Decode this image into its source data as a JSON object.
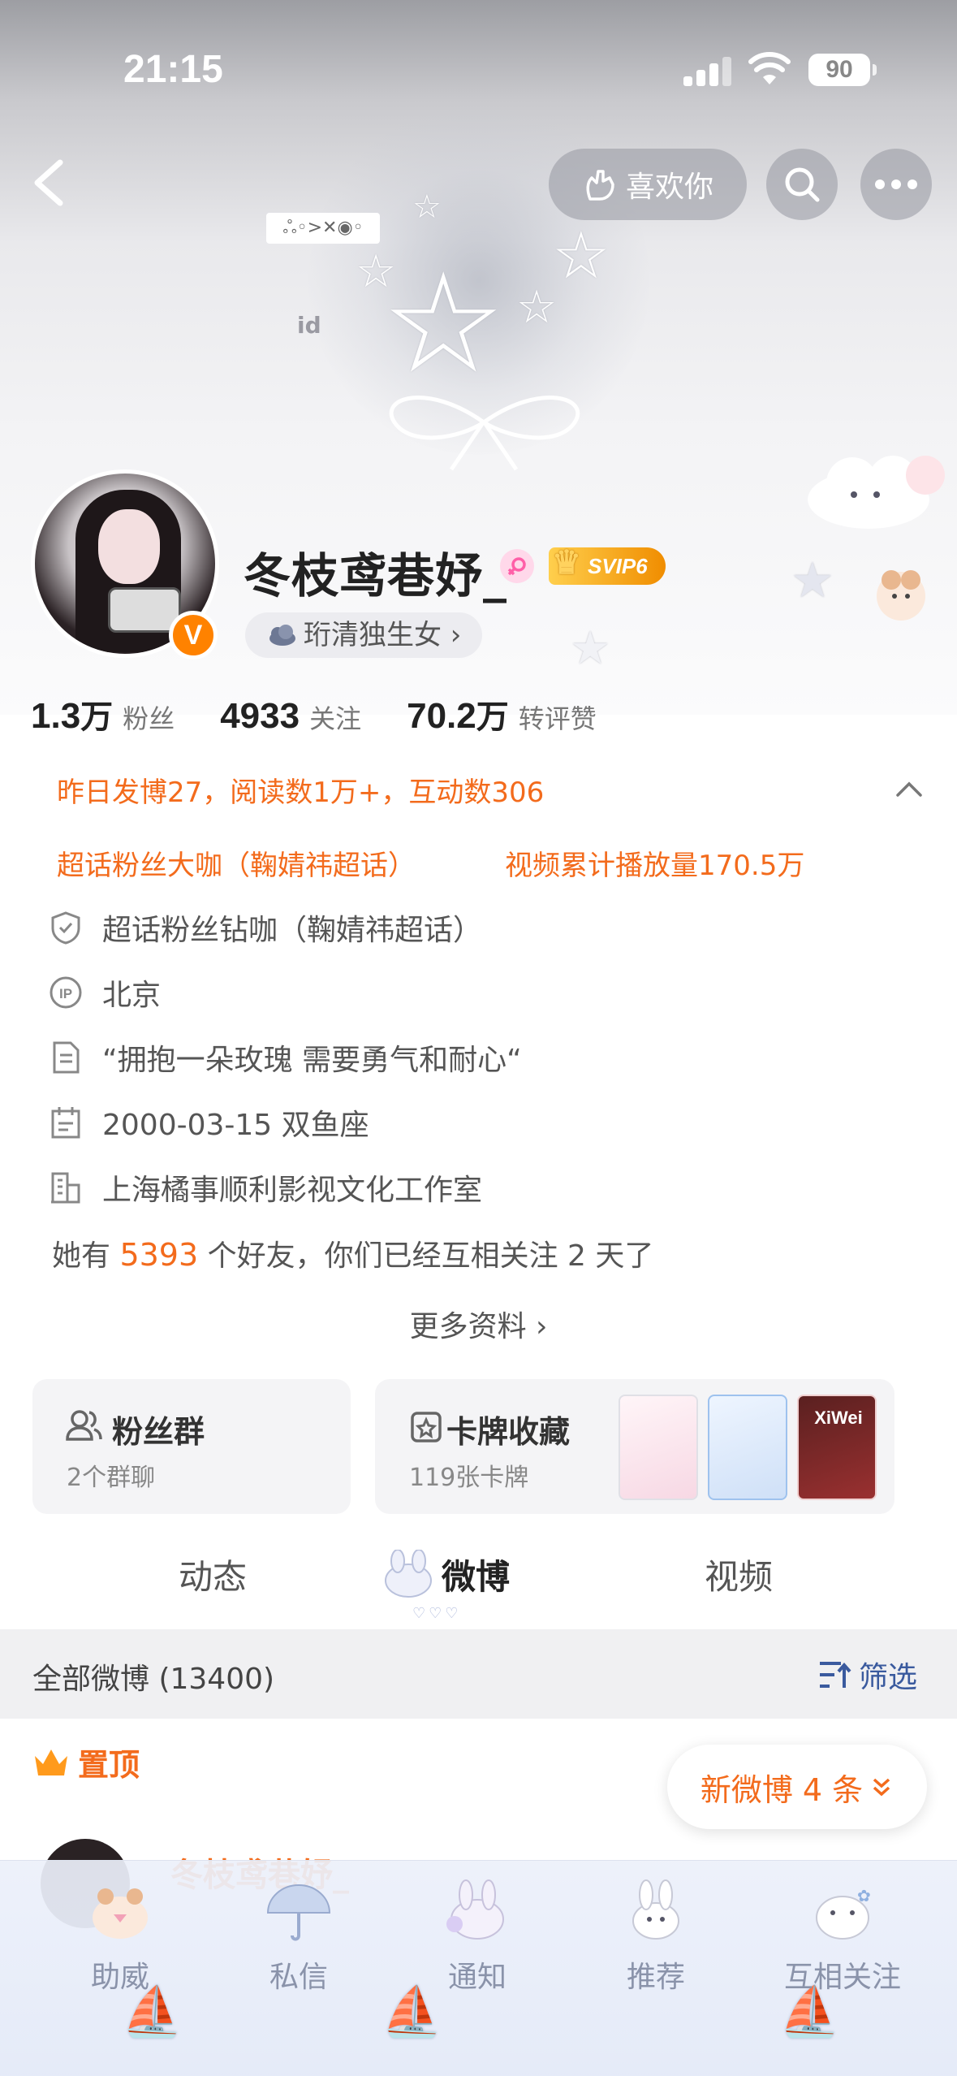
{
  "status_bar": {
    "time": "21:15",
    "battery": "90"
  },
  "header": {
    "like_button": "喜欢你",
    "banner_sticker_text": "ஃ◦>✕◉◦",
    "banner_small_text": "id"
  },
  "profile": {
    "username": "冬枝鸢巷妤_",
    "vip_badge": "SVIP6",
    "verified_mark": "V",
    "tag": "珩清独生女 ›",
    "stats": [
      {
        "num": "1.3",
        "unit": "万",
        "label": "粉丝"
      },
      {
        "num": "4933",
        "unit": "",
        "label": "关注"
      },
      {
        "num": "70.2",
        "unit": "万",
        "label": "转评赞"
      }
    ]
  },
  "info": {
    "yesterday": "昨日发博27，阅读数1万+，互动数306",
    "super_fan": "超话粉丝大咖（鞠婧祎超话）",
    "video_plays": "视频累计播放量170.5万",
    "rows": [
      {
        "icon": "shield-icon",
        "text": "超话粉丝钻咖（鞠婧祎超话）"
      },
      {
        "icon": "ip-icon",
        "text": "北京"
      },
      {
        "icon": "document-icon",
        "text": "“拥抱一朵玫瑰 需要勇气和耐心“"
      },
      {
        "icon": "calendar-icon",
        "text": "2000-03-15 双鱼座"
      },
      {
        "icon": "building-icon",
        "text": "上海橘事顺利影视文化工作室"
      }
    ],
    "friends_prefix": "她有 ",
    "friends_count": "5393",
    "friends_suffix": " 个好友，你们已经互相关注 2 天了",
    "more": "更多资料 ›"
  },
  "cards": {
    "fan_group": {
      "title": "粉丝群",
      "sub": "2个群聊"
    },
    "card_collection": {
      "title": "卡牌收藏",
      "sub": "119张卡牌",
      "thumb_label": "XiWei"
    }
  },
  "tabs": [
    "动态",
    "微博",
    "视频"
  ],
  "filter_bar": {
    "all": "全部微博 (13400)",
    "filter": "筛选"
  },
  "pinned": "置顶",
  "new_posts": "新微博 4 条",
  "post": {
    "name": "冬枝鸢巷妤_"
  },
  "bottom_bar": [
    "助威",
    "私信",
    "通知",
    "推荐",
    "互相关注"
  ],
  "colors": {
    "accent": "#f36b1c",
    "verified": "#ff8200",
    "link": "#3a5a9e"
  }
}
